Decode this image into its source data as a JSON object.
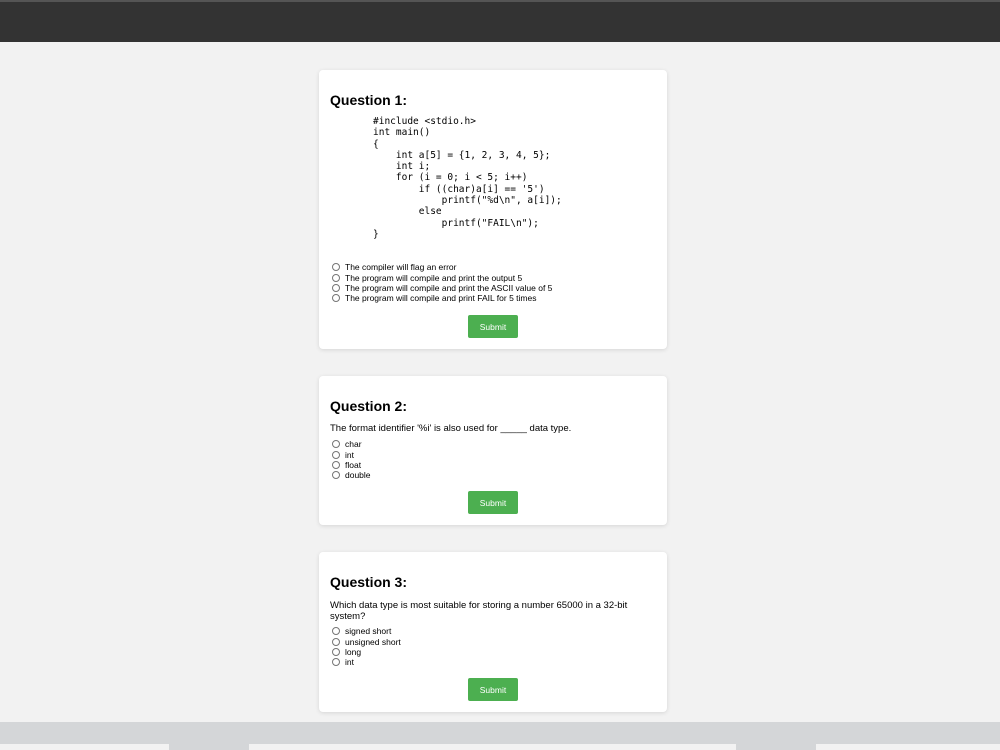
{
  "questions": [
    {
      "title": "Question 1:",
      "code": "#include <stdio.h>\nint main()\n{\n    int a[5] = {1, 2, 3, 4, 5};\n    int i;\n    for (i = 0; i < 5; i++)\n        if ((char)a[i] == '5')\n            printf(\"%d\\n\", a[i]);\n        else\n            printf(\"FAIL\\n\");\n}",
      "options": [
        "The compiler will flag an error",
        "The program will compile and print the output 5",
        "The program will compile and print the ASCII value of 5",
        "The program will compile and print FAIL for 5 times"
      ],
      "submit_label": "Submit"
    },
    {
      "title": "Question 2:",
      "text": "The format identifier '%i' is also used for _____ data type.",
      "options": [
        "char",
        "int",
        "float",
        "double"
      ],
      "submit_label": "Submit"
    },
    {
      "title": "Question 3:",
      "text": "Which data type is most suitable for storing a number 65000 in a 32-bit system?",
      "options": [
        "signed short",
        "unsigned short",
        "long",
        "int"
      ],
      "submit_label": "Submit"
    }
  ],
  "colors": {
    "header": "#333333",
    "background": "#f2f2f2",
    "submit": "#4caf50"
  }
}
